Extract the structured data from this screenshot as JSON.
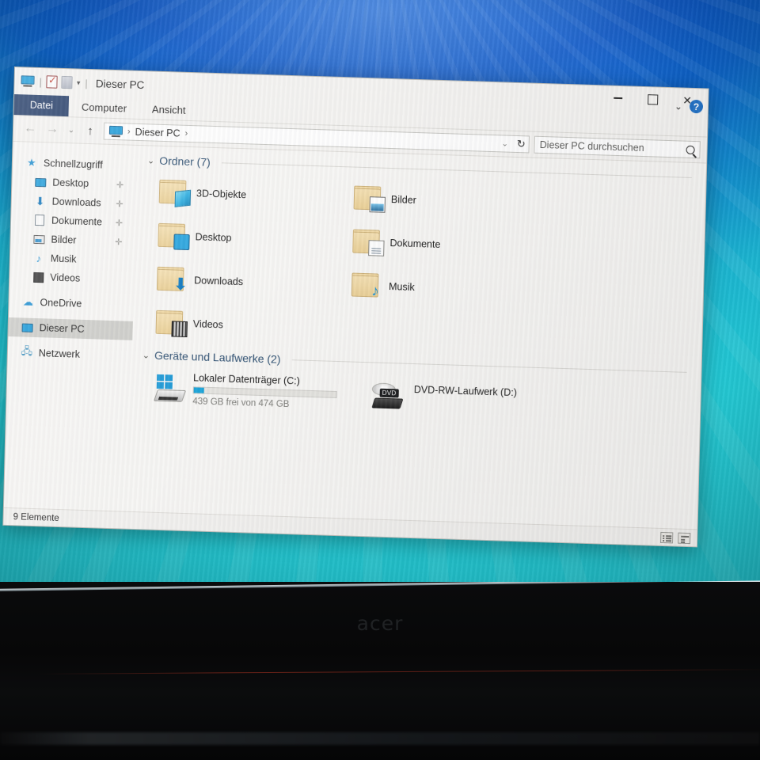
{
  "device": {
    "brand": "acer"
  },
  "window": {
    "title": "Dieser PC",
    "quick_access": [
      {
        "name": "this-pc-icon",
        "label": "Dieser PC"
      },
      {
        "name": "properties-icon",
        "label": "Eigenschaften"
      },
      {
        "name": "new-folder-icon",
        "label": "Neuer Ordner"
      },
      {
        "name": "customize-qat-caret",
        "label": "▾"
      }
    ],
    "controls": {
      "minimize": "Minimieren",
      "maximize": "Maximieren",
      "close": "Schließen",
      "ribbon_chevron": "⌄",
      "help": "?"
    }
  },
  "tabs": [
    {
      "label": "Datei",
      "selected": true
    },
    {
      "label": "Computer",
      "selected": false
    },
    {
      "label": "Ansicht",
      "selected": false
    }
  ],
  "navigation": {
    "back": "←",
    "forward": "→",
    "recent": "⌄",
    "up": "↑",
    "address": {
      "crumb": "Dieser PC",
      "sep1": "›",
      "sep2": "›",
      "history_caret": "⌄",
      "refresh": "↻"
    },
    "search": {
      "placeholder": "Dieser PC durchsuchen",
      "icon": "search-icon"
    }
  },
  "sidebar": {
    "items": [
      {
        "label": "Schnellzugriff",
        "icon": "star-icon",
        "indent": false,
        "pinned": false,
        "selected": false
      },
      {
        "label": "Desktop",
        "icon": "monitor-icon",
        "indent": true,
        "pinned": true,
        "selected": false
      },
      {
        "label": "Downloads",
        "icon": "download-icon",
        "indent": true,
        "pinned": true,
        "selected": false
      },
      {
        "label": "Dokumente",
        "icon": "document-icon",
        "indent": true,
        "pinned": true,
        "selected": false
      },
      {
        "label": "Bilder",
        "icon": "picture-icon",
        "indent": true,
        "pinned": true,
        "selected": false
      },
      {
        "label": "Musik",
        "icon": "music-note-icon",
        "indent": true,
        "pinned": false,
        "selected": false
      },
      {
        "label": "Videos",
        "icon": "film-icon",
        "indent": true,
        "pinned": false,
        "selected": false
      },
      {
        "label": "OneDrive",
        "icon": "cloud-icon",
        "indent": false,
        "pinned": false,
        "selected": false
      },
      {
        "label": "Dieser PC",
        "icon": "monitor-icon",
        "indent": false,
        "pinned": false,
        "selected": true
      },
      {
        "label": "Netzwerk",
        "icon": "network-icon",
        "indent": false,
        "pinned": false,
        "selected": false
      }
    ],
    "pin_glyph": "📌"
  },
  "groups": [
    {
      "name": "folders",
      "header": "Ordner (7)",
      "chevron": "⌄",
      "items": [
        {
          "label": "3D-Objekte",
          "badge": "cube-icon"
        },
        {
          "label": "Bilder",
          "badge": "photo-icon"
        },
        {
          "label": "Desktop",
          "badge": "monitor-icon"
        },
        {
          "label": "Dokumente",
          "badge": "document-icon"
        },
        {
          "label": "Downloads",
          "badge": "download-arrow-icon"
        },
        {
          "label": "Musik",
          "badge": "music-note-icon"
        },
        {
          "label": "Videos",
          "badge": "film-icon"
        }
      ]
    },
    {
      "name": "devices",
      "header": "Geräte und Laufwerke (2)",
      "chevron": "⌄",
      "drives": [
        {
          "label": "Lokaler Datenträger (C:)",
          "free_text": "439 GB frei von 474 GB",
          "used_percent": 7,
          "icon": "hard-drive-windows-icon",
          "bar_color": "#19a3d8"
        },
        {
          "label": "DVD-RW-Laufwerk (D:)",
          "free_text": "",
          "used_percent": 0,
          "icon": "dvd-drive-icon",
          "badge_text": "DVD"
        }
      ]
    }
  ],
  "statusbar": {
    "count": "9 Elemente",
    "views": [
      {
        "name": "details-view-button",
        "label": "Details"
      },
      {
        "name": "large-icons-view-button",
        "label": "Große Symbole"
      }
    ]
  },
  "colors": {
    "file_tab": "#1f3864",
    "accent": "#19a3d8",
    "group_header": "#2a4c6e",
    "window_bg": "#f2f1ef"
  }
}
